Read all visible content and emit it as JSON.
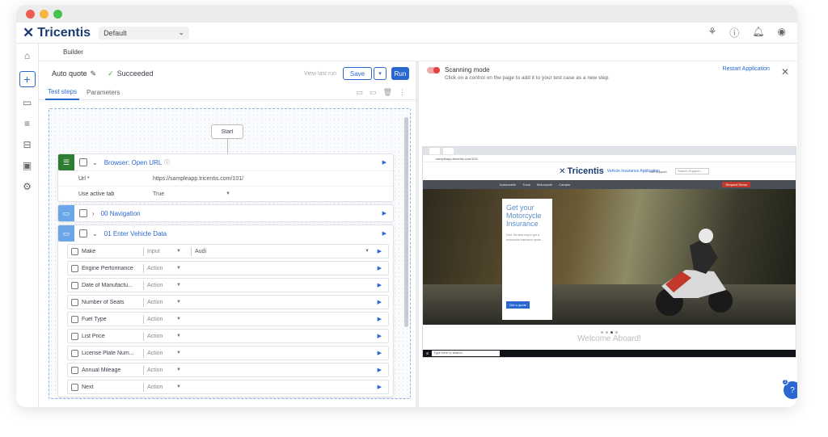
{
  "app": {
    "logo_text": "Tricentis",
    "project": "Default",
    "builder_tab": "Builder"
  },
  "testcase": {
    "name": "Auto quote",
    "status": "Succeeded",
    "view_last_run": "View last run",
    "save_label": "Save",
    "run_label": "Run"
  },
  "tabs": [
    "Test steps",
    "Parameters"
  ],
  "canvas": {
    "start_label": "Start",
    "browser_block": {
      "title": "Browser: Open URL",
      "params": [
        {
          "name": "Url *",
          "value": "https://sampleapp.tricentis.com/101/"
        },
        {
          "name": "Use active tab",
          "value": "True"
        }
      ]
    },
    "nav_block": {
      "title": "00 Navigation"
    },
    "vehicle_block": {
      "title": "01 Enter Vehicle Data",
      "steps": [
        {
          "name": "Make",
          "type": "Input",
          "value": "Audi"
        },
        {
          "name": "Engine Performance",
          "type": "Action",
          "value": ""
        },
        {
          "name": "Date of Manufactu...",
          "type": "Action",
          "value": ""
        },
        {
          "name": "Number of Seats",
          "type": "Action",
          "value": ""
        },
        {
          "name": "Fuel Type",
          "type": "Action",
          "value": ""
        },
        {
          "name": "List Price",
          "type": "Action",
          "value": ""
        },
        {
          "name": "License Plate Num...",
          "type": "Action",
          "value": ""
        },
        {
          "name": "Annual Mileage",
          "type": "Action",
          "value": ""
        },
        {
          "name": "Next",
          "type": "Action",
          "value": ""
        }
      ]
    }
  },
  "scan": {
    "title": "Scanning mode",
    "subtitle": "Click on a control on the page to add it to your test case as a new step.",
    "restart_label": "Restart Application"
  },
  "preview": {
    "site_logo": "Tricentis",
    "site_sub": "Vehicle Insurance Application",
    "support": "Get Support",
    "search_placeholder": "Search Support...",
    "nav": [
      "Automobile",
      "Truck",
      "Motorcycle",
      "Camper"
    ],
    "quote_btn": "Request Demo",
    "hero_title": "Get your Motorcycle Insurance",
    "hero_text": "Fast, the best way to get a motorcycle insurance quote...",
    "hero_btn": "Get a quote",
    "welcome": "Welcome Aboard!",
    "taskbar_search": "Type here to search"
  },
  "help_badge": "1",
  "colors": {
    "accent": "#2b67d1",
    "module_green": "#2e7d32",
    "folder_blue": "#6ba7e8"
  }
}
